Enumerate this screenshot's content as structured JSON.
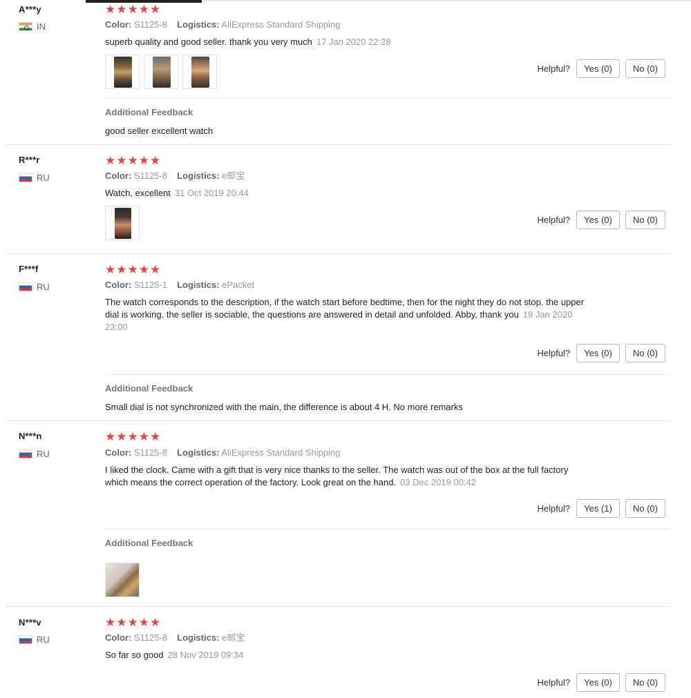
{
  "labels": {
    "color": "Color:",
    "logistics": "Logistics:",
    "helpful": "Helpful?",
    "additional_feedback": "Additional Feedback"
  },
  "stars": "★★★★★",
  "reviews": [
    {
      "user": "A***y",
      "country": "IN",
      "color": "S1125-8",
      "logistics": "AliExpress Standard Shipping",
      "text": "superb quality and good seller. thank you very much",
      "date": "17 Jan 2020 22:28",
      "yes": "Yes (0)",
      "no": "No (0)",
      "additional_feedback": "good seller excellent watch"
    },
    {
      "user": "R***r",
      "country": "RU",
      "color": "S1125-8",
      "logistics": "e邮宝",
      "text": "Watch, excellent",
      "date": "31 Oct 2019 20:44",
      "yes": "Yes (0)",
      "no": "No (0)"
    },
    {
      "user": "F***f",
      "country": "RU",
      "color": "S1125-1",
      "logistics": "ePacket",
      "text": "The watch corresponds to the description, if the watch start before bedtime, then for the night they do not stop. the upper dial is working. the seller is sociable, the questions are answered in detail and unfolded. Abby, thank you",
      "date": "19 Jan 2020 23:00",
      "yes": "Yes (0)",
      "no": "No (0)",
      "additional_feedback": "Small dial is not synchronized with the main, the difference is about 4 H. No more remarks"
    },
    {
      "user": "N***n",
      "country": "RU",
      "color": "S1125-8",
      "logistics": "AliExpress Standard Shipping",
      "text": "I liked the clock. Came with a gift that is very nice thanks to the seller. The watch was out of the box at the full factory which means the correct operation of the factory. Look great on the hand.",
      "date": "03 Dec 2019 00:42",
      "yes": "Yes (1)",
      "no": "No (0)"
    },
    {
      "user": "N***v",
      "country": "RU",
      "color": "S1125-8",
      "logistics": "e邮宝",
      "text": "So far so good",
      "date": "28 Nov 2019 09:34",
      "yes": "Yes (0)",
      "no": "No (0)"
    }
  ]
}
